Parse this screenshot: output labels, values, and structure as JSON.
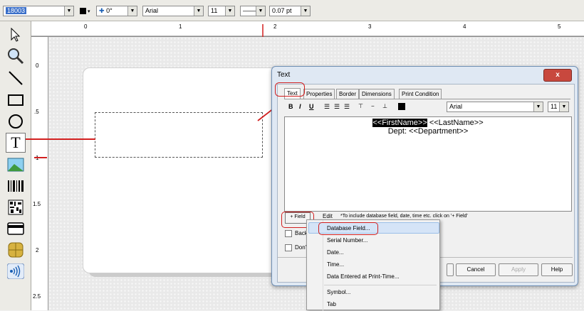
{
  "toolbar": {
    "color_value": "18003",
    "rotation": "0°",
    "font": "Arial",
    "size": "11",
    "line_width": "0.07 pt"
  },
  "ruler": {
    "h_numbers": [
      "0",
      "1",
      "2",
      "3",
      "4",
      "5"
    ],
    "v_numbers": [
      "0",
      ".5",
      "1",
      "1.5",
      "2",
      "2.5"
    ]
  },
  "dialog": {
    "title": "Text",
    "close": "x",
    "tabs": [
      "Text",
      "Properties",
      "Border",
      "Dimensions",
      "Print Condition"
    ],
    "format_font": "Arial",
    "format_size": "11",
    "editor": {
      "field1": "<<FirstName>>",
      "field2": " <<LastName>>",
      "line2": "Dept: <<Department>>"
    },
    "field_button": "+ Field",
    "edit_button": "Edit",
    "hint": "*To include database field, date, time etc. click on '+ Field'",
    "checkbox1": "Back",
    "checkbox2": "Don't",
    "buttons": {
      "cancel": "Cancel",
      "apply": "Apply",
      "help": "Help"
    }
  },
  "menu": {
    "items": [
      "Database Field...",
      "Serial Number...",
      "Date...",
      "Time...",
      "Data Entered at Print-Time...",
      "Symbol...",
      "Tab"
    ]
  },
  "colors": {
    "annotation": "#d21f1f",
    "highlight": "#000000"
  }
}
